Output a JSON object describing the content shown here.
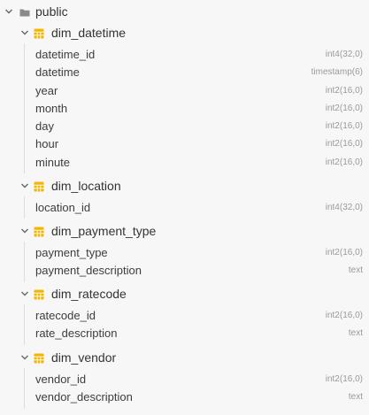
{
  "schema": {
    "name": "public",
    "tables": [
      {
        "name": "dim_datetime",
        "columns": [
          {
            "name": "datetime_id",
            "type": "int4(32,0)"
          },
          {
            "name": "datetime",
            "type": "timestamp(6)"
          },
          {
            "name": "year",
            "type": "int2(16,0)"
          },
          {
            "name": "month",
            "type": "int2(16,0)"
          },
          {
            "name": "day",
            "type": "int2(16,0)"
          },
          {
            "name": "hour",
            "type": "int2(16,0)"
          },
          {
            "name": "minute",
            "type": "int2(16,0)"
          }
        ]
      },
      {
        "name": "dim_location",
        "columns": [
          {
            "name": "location_id",
            "type": "int4(32,0)"
          }
        ]
      },
      {
        "name": "dim_payment_type",
        "columns": [
          {
            "name": "payment_type",
            "type": "int2(16,0)"
          },
          {
            "name": "payment_description",
            "type": "text"
          }
        ]
      },
      {
        "name": "dim_ratecode",
        "columns": [
          {
            "name": "ratecode_id",
            "type": "int2(16,0)"
          },
          {
            "name": "rate_description",
            "type": "text"
          }
        ]
      },
      {
        "name": "dim_vendor",
        "columns": [
          {
            "name": "vendor_id",
            "type": "int2(16,0)"
          },
          {
            "name": "vendor_description",
            "type": "text"
          }
        ]
      }
    ]
  },
  "icons": {
    "expand": "chevron-down-icon",
    "schema": "folder-icon",
    "table": "table-icon"
  },
  "colors": {
    "table_icon": "#f2b705",
    "folder_icon": "#8a8a8a",
    "chevron": "#666666"
  }
}
